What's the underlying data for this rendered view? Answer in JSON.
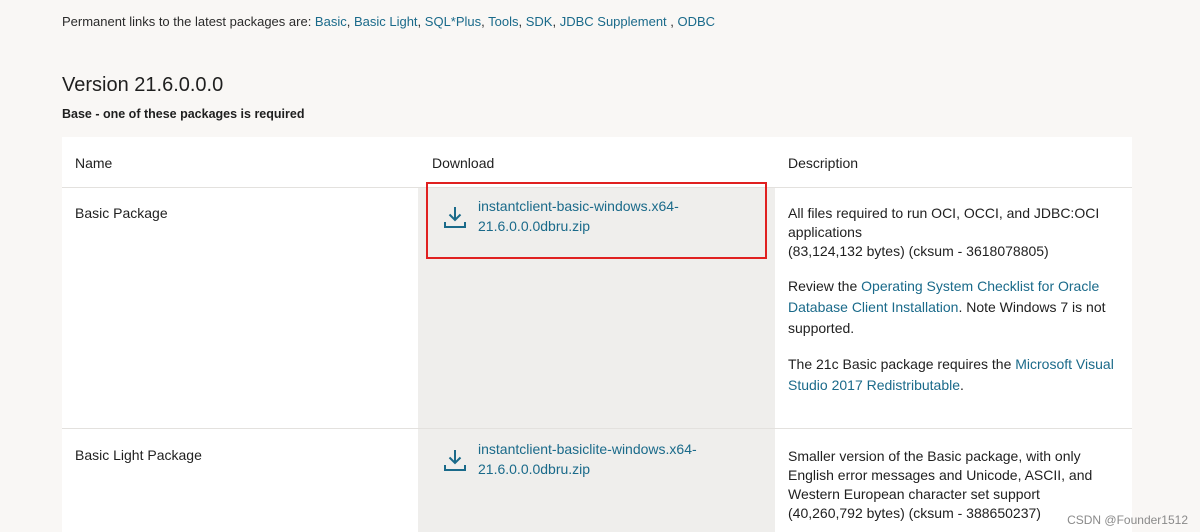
{
  "permalinks": {
    "prefix": "Permanent links to the latest packages are: ",
    "links": [
      "Basic",
      "Basic Light",
      "SQL*Plus",
      "Tools",
      "SDK",
      "JDBC Supplement",
      "ODBC"
    ]
  },
  "version_title": "Version 21.6.0.0.0",
  "base_note": "Base - one of these packages is required",
  "table": {
    "headers": [
      "Name",
      "Download",
      "Description"
    ],
    "rows": [
      {
        "name": "Basic Package",
        "download_line1": "instantclient-basic-windows.x64-",
        "download_line2": "21.6.0.0.0dbru.zip",
        "desc_1_line1": "All files required to run OCI, OCCI, and JDBC:OCI",
        "desc_1_line2": "applications",
        "desc_1_line3": "(83,124,132 bytes) (cksum - 3618078805)",
        "desc_2_prefix": "Review the ",
        "desc_2_link": "Operating System Checklist for Oracle Database Client Installation",
        "desc_2_suffix": ". Note Windows 7 is not supported.",
        "desc_3_prefix": "The 21c Basic package requires the ",
        "desc_3_link": "Microsoft Visual Studio 2017 Redistributable",
        "desc_3_suffix": "."
      },
      {
        "name": "Basic Light Package",
        "download_line1": "instantclient-basiclite-windows.x64-",
        "download_line2": "21.6.0.0.0dbru.zip",
        "desc_1_line1": "Smaller version of the Basic package, with only",
        "desc_1_line2": "English error messages and Unicode, ASCII, and",
        "desc_1_line3": "Western European character set support",
        "desc_1_line4": "(40,260,792 bytes) (cksum - 388650237)"
      }
    ]
  },
  "icons": {
    "download": "download-icon"
  },
  "colors": {
    "link": "#1a6a8a",
    "highlight": "#e02020"
  },
  "watermark": "CSDN @Founder1512"
}
